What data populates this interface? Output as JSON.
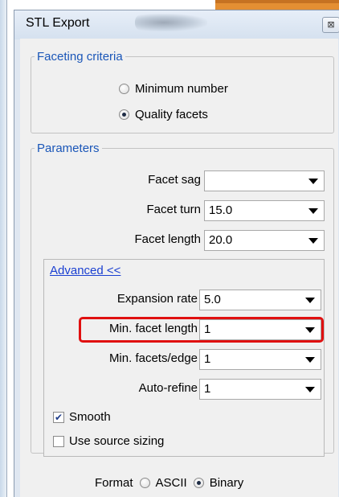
{
  "dialog": {
    "title": "STL Export",
    "close_glyph": "⊠"
  },
  "faceting": {
    "legend": "Faceting criteria",
    "options": [
      {
        "label": "Minimum number",
        "checked": false
      },
      {
        "label": "Quality facets",
        "checked": true
      }
    ]
  },
  "parameters": {
    "legend": "Parameters",
    "fields": [
      {
        "label": "Facet sag",
        "value": ""
      },
      {
        "label": "Facet turn",
        "value": "15.0"
      },
      {
        "label": "Facet length",
        "value": "20.0"
      }
    ]
  },
  "advanced": {
    "link": "Advanced <<",
    "fields": [
      {
        "label": "Expansion rate",
        "value": "5.0"
      },
      {
        "label": "Min. facet length",
        "value": "1"
      },
      {
        "label": "Min. facets/edge",
        "value": "1"
      },
      {
        "label": "Auto-refine",
        "value": "1"
      }
    ],
    "smooth": {
      "label": "Smooth",
      "checked": true
    },
    "use_source_sizing": {
      "label": "Use source sizing",
      "checked": false
    }
  },
  "format": {
    "label": "Format",
    "options": [
      {
        "label": "ASCII",
        "checked": false
      },
      {
        "label": "Binary",
        "checked": true
      }
    ]
  },
  "colors": {
    "accent": "#1a56b8",
    "highlight": "#e01010",
    "link": "#1a3fd1"
  }
}
